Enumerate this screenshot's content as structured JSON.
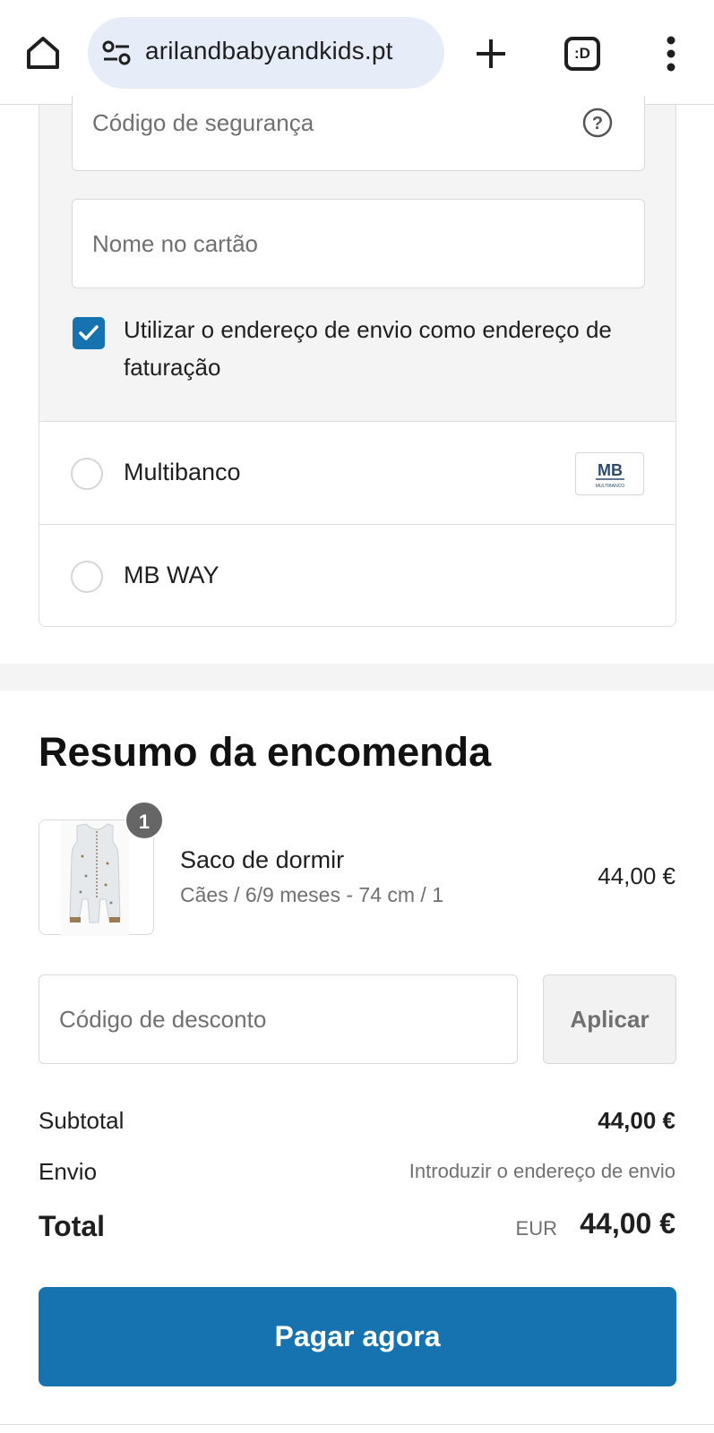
{
  "browser": {
    "url": "arilandbabyandkids.pt",
    "tab_count": ":D",
    "icons": [
      "home-icon",
      "site-settings-icon",
      "new-tab-icon",
      "tab-switcher-icon",
      "more-menu-icon"
    ]
  },
  "payment": {
    "security_code_placeholder": "Código de segurança",
    "name_on_card_placeholder": "Nome no cartão",
    "use_shipping_as_billing_label": "Utilizar o endereço de envio como endereço de faturação",
    "use_shipping_as_billing_checked": true,
    "methods": [
      {
        "label": "Multibanco",
        "logo_text": "MB",
        "logo_subtext": "MULTIBANCO"
      },
      {
        "label": "MB WAY"
      }
    ]
  },
  "summary": {
    "title": "Resumo da encomenda",
    "items": [
      {
        "name": "Saco de dormir",
        "variant": "Cães / 6/9 meses - 74 cm / 1",
        "price": "44,00 €",
        "quantity": "1"
      }
    ],
    "discount_placeholder": "Código de desconto",
    "apply_label": "Aplicar",
    "subtotal_label": "Subtotal",
    "subtotal_value": "44,00 €",
    "shipping_label": "Envio",
    "shipping_value": "Introduzir o endereço de envio",
    "total_label": "Total",
    "total_currency": "EUR",
    "total_value": "44,00 €",
    "pay_button_label": "Pagar agora"
  },
  "colors": {
    "accent": "#1773b0",
    "panel_bg": "#f4f4f4",
    "url_bar_bg": "#e6edf8"
  }
}
